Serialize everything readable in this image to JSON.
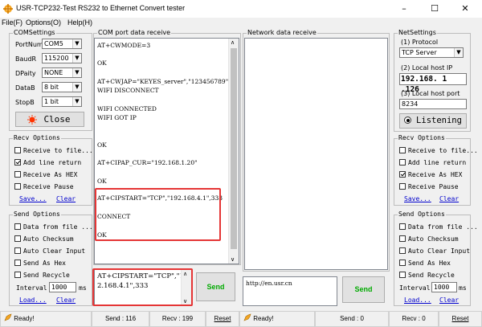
{
  "window": {
    "title": "USR-TCP232-Test  RS232 to Ethernet Convert tester",
    "minimize": "–",
    "maximize": "☐",
    "close": "✕"
  },
  "menu": {
    "file": "File(F)",
    "options": "Options(O)",
    "help": "Help(H)"
  },
  "com_settings": {
    "title": "COMSettings",
    "port_label": "PortNum",
    "port_value": "COM5",
    "baud_label": "BaudR",
    "baud_value": "115200",
    "parity_label": "DPaity",
    "parity_value": "NONE",
    "databits_label": "DataB",
    "databits_value": "8 bit",
    "stopbits_label": "StopB",
    "stopbits_value": "1 bit",
    "close_button": "Close"
  },
  "recv_options_left": {
    "title": "Recv Options",
    "receive_to_file": "Receive to file...",
    "add_line_return": "Add line return",
    "receive_as_hex": "Receive As HEX",
    "receive_pause": "Receive Pause",
    "save": "Save...",
    "clear": "Clear"
  },
  "send_options_left": {
    "title": "Send Options",
    "data_from_file": "Data from file ...",
    "auto_checksum": "Auto Checksum",
    "auto_clear_input": "Auto Clear Input",
    "send_as_hex": "Send As Hex",
    "send_recycle": "Send Recycle",
    "interval_label": "Interval",
    "interval_value": "1000",
    "interval_unit": "ms",
    "load": "Load...",
    "clear": "Clear"
  },
  "com_receive": {
    "title": "COM port data receive",
    "lines": [
      "AT+CWMODE=3",
      "OK",
      "AT+CWJAP=\"KEYES_server\",\"123456789\"",
      "WIFI DISCONNECT",
      "WIFI CONNECTED",
      "WIFI GOT IP",
      "OK",
      "AT+CIPAP_CUR=\"192.168.1.20\"",
      "OK",
      "AT+CIPSTART=\"TCP\",\"192.168.4.1\",333",
      "CONNECT",
      "OK"
    ]
  },
  "com_send": {
    "line1": "AT+CIPSTART=\"TCP\",\"19",
    "line2": "2.168.4.1\",333",
    "send_button": "Send"
  },
  "network_receive": {
    "title": "Network data receive"
  },
  "network_send": {
    "text": "http://en.usr.cn",
    "send_button": "Send"
  },
  "net_settings": {
    "title": "NetSettings",
    "protocol_label": "(1) Protocol",
    "protocol_value": "TCP Server",
    "host_ip_label": "(2) Local host IP",
    "host_ip_value": "192.168. 1 .126",
    "host_port_label": "(3) Local host port",
    "host_port_value": "8234",
    "listening_button": "Listening"
  },
  "recv_options_right": {
    "title": "Recv Options",
    "receive_to_file": "Receive to file...",
    "add_line_return": "Add line return",
    "receive_as_hex": "Receive As HEX",
    "receive_pause": "Receive Pause",
    "save": "Save...",
    "clear": "Clear"
  },
  "send_options_right": {
    "title": "Send Options",
    "data_from_file": "Data from file ...",
    "auto_checksum": "Auto Checksum",
    "auto_clear_input": "Auto Clear Input",
    "send_as_hex": "Send As Hex",
    "send_recycle": "Send Recycle",
    "interval_label": "Interval",
    "interval_value": "1000",
    "interval_unit": "ms",
    "load": "Load...",
    "clear": "Clear"
  },
  "status_left": {
    "ready": "Ready!",
    "send": "Send : 116",
    "recv": "Recv : 199",
    "reset": "Reset"
  },
  "status_right": {
    "ready": "Ready!",
    "send": "Send : 0",
    "recv": "Recv : 0",
    "reset": "Reset"
  },
  "colors": {
    "highlight": "#e53535",
    "link": "#0000cc",
    "close_icon": "#ff3300"
  }
}
